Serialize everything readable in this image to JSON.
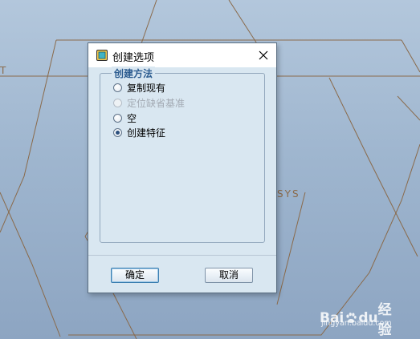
{
  "background": {
    "label_left": "T",
    "label_right": "SYS"
  },
  "dialog": {
    "title": "创建选项",
    "group_title": "创建方法",
    "options": [
      {
        "label": "复制现有",
        "checked": false,
        "enabled": true
      },
      {
        "label": "定位缺省基准",
        "checked": false,
        "enabled": false
      },
      {
        "label": "空",
        "checked": false,
        "enabled": true
      },
      {
        "label": "创建特征",
        "checked": true,
        "enabled": true
      }
    ],
    "ok_label": "确定",
    "cancel_label": "取消"
  },
  "watermark": {
    "brand_left": "Bai",
    "brand_mid": "du",
    "brand_right": "经验",
    "url": "jingyan.baidu.com"
  },
  "colors": {
    "accent": "#2b5b8f",
    "dialog_bg": "#d9e7f1",
    "cad_lines": "#8a6a4a"
  }
}
